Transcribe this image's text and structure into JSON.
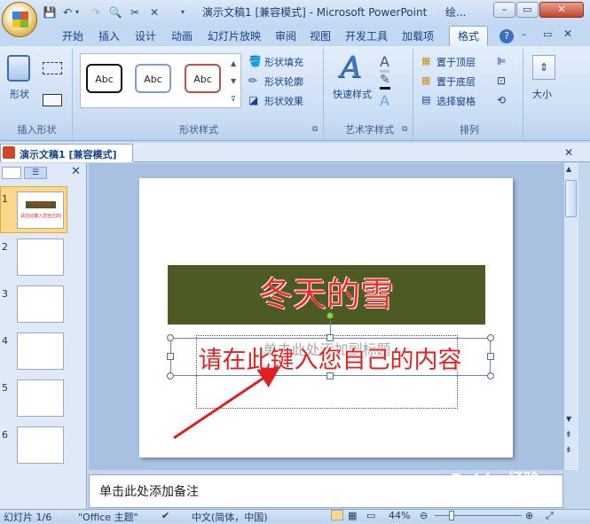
{
  "window": {
    "title": "演示文稿1 [兼容模式] - Microsoft PowerPoint",
    "title_extra": "绘...",
    "min": "–",
    "restore": "▭",
    "close": "✕"
  },
  "quick_access": [
    "save-icon",
    "undo-icon",
    "redo-icon",
    "print-preview-icon",
    "cut-icon",
    "dropdown-icon"
  ],
  "tabs": [
    "开始",
    "插入",
    "设计",
    "动画",
    "幻灯片放映",
    "审阅",
    "视图",
    "开发工具",
    "加载项",
    "格式"
  ],
  "help": "?",
  "ribbon": {
    "insert_shapes": {
      "shapes_label": "形状",
      "group_label": "插入形状"
    },
    "shape_styles": {
      "gallery": [
        "Abc",
        "Abc",
        "Abc"
      ],
      "fill": "形状填充",
      "outline": "形状轮廓",
      "effects": "形状效果",
      "group_label": "形状样式"
    },
    "wordart": {
      "quick_styles": "快速样式",
      "group_label": "艺术字样式"
    },
    "arrange": {
      "bring_front": "置于顶层",
      "send_back": "置于底层",
      "selection_pane": "选择窗格",
      "group_label": "排列"
    },
    "size": {
      "label": "大小"
    }
  },
  "doc_tab": {
    "title": "演示文稿1 [兼容模式]"
  },
  "slides": {
    "numbers": [
      "1",
      "2",
      "3",
      "4",
      "5",
      "6"
    ],
    "thumb1_title": "冬天的雪",
    "thumb1_sub": "请在此键入您自己的内容"
  },
  "slide": {
    "title": "冬天的雪",
    "subtitle_placeholder": "单击此处添加副标题",
    "wordart": "请在此键入您自己的内容"
  },
  "notes": {
    "placeholder": "单击此处添加备注"
  },
  "status": {
    "slide_count": "幻灯片 1/6",
    "theme": "\"Office 主题\"",
    "language": "中文(简体，中国)",
    "zoom": "44%"
  },
  "watermark": {
    "text": "Baidu 经验",
    "sub": "jingyan.baidu.com"
  },
  "colors": {
    "title_box": "#4d5a23",
    "title_text": "#f32a2a",
    "arrow": "#e02020",
    "accent": "#15428b"
  }
}
